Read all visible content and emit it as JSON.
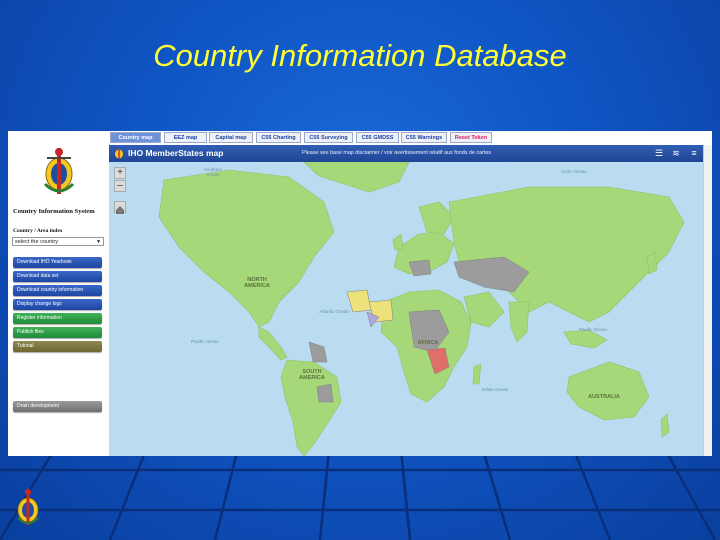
{
  "slide": {
    "title": "Country Information Database"
  },
  "left_panel": {
    "system_title": "Country Information System",
    "country_label": "Country / Area index",
    "country_select": "select the country",
    "buttons": [
      {
        "label": "Download IHO Yearbook",
        "color": "blue"
      },
      {
        "label": "Download data set",
        "color": "blue"
      },
      {
        "label": "Download country information",
        "color": "blue"
      },
      {
        "label": "Display change logs",
        "color": "blue"
      },
      {
        "label": "Register information",
        "color": "green"
      },
      {
        "label": "Publish files",
        "color": "green"
      },
      {
        "label": "Tutorial",
        "color": "brown"
      }
    ],
    "user_button": "Drain development"
  },
  "tabs": [
    {
      "label": "Country map",
      "active": true
    },
    {
      "label": "EEZ map"
    },
    {
      "label": "Capital map"
    },
    {
      "label": "C55 Charting"
    },
    {
      "label": "C55 Surveying"
    },
    {
      "label": "C55 GMDSS"
    },
    {
      "label": "C55 Warnings"
    },
    {
      "label": "Reset Token"
    }
  ],
  "map": {
    "title": "IHO MemberStates map",
    "notice": "Please see base map disclaimer / voir avertissement relatif aux fonds de cartes",
    "zoom_in": "+",
    "zoom_out": "–",
    "labels": {
      "north_america": "NORTH AMERICA",
      "south_america": "SOUTH AMERICA",
      "africa": "AFRICA",
      "australia": "AUSTRALIA",
      "atlantic": "Atlantic Ocean",
      "pacific_left": "Pacific Ocean",
      "pacific_right": "Pacific Ocean",
      "indian": "Indian Ocean",
      "arctic": "Arctic Ocean",
      "southern": "Southern Ocean"
    },
    "colors": {
      "land": "#a6d87a",
      "member": "#c9e48a",
      "pending": "#9c9c9c",
      "highlight": "#e06f6a",
      "yellow": "#ece17a"
    }
  },
  "icons": [
    "iho-crest-icon",
    "list-icon",
    "layers-icon",
    "menu-icon",
    "home-icon"
  ]
}
